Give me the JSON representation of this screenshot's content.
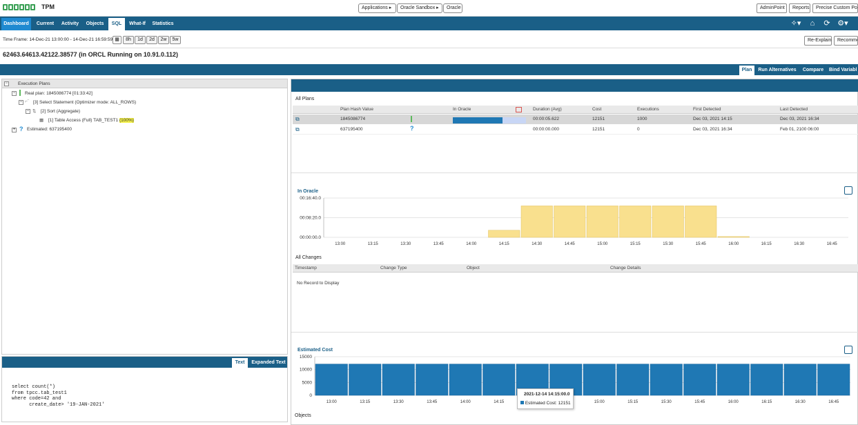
{
  "header": {
    "app_title": "TPM",
    "breadcrumbs": [
      "Applications",
      "Oracle Sandbox",
      "Oracle"
    ],
    "right_buttons": [
      "AdminPoint",
      "Reports",
      "Precise Custom Porta"
    ]
  },
  "nav": {
    "tabs": [
      "Dashboard",
      "Current",
      "Activity",
      "Objects",
      "SQL",
      "What-If",
      "Statistics"
    ],
    "active": "SQL"
  },
  "timeframe": {
    "label": "Time Frame: 14-Dec-21 13:00:00 - 14-Dec-21 16:59:59",
    "ranges": [
      "8h",
      "1d",
      "2d",
      "2w",
      "5w"
    ],
    "actions": [
      "Re-Explain",
      "Recommen"
    ]
  },
  "sql_id": "62463.64613.42122.38577 (in ORCL Running on 10.91.0.112)",
  "subtabs": {
    "items": [
      "Plan",
      "Run Alternatives",
      "Compare",
      "Bind Variabl"
    ],
    "active": "Plan"
  },
  "tree": {
    "header": "Execution Plans",
    "real_plan": "Real plan: 1845086774 [01:33:42]",
    "select": "[3] Select Statement (Optimizer mode: ALL_ROWS)",
    "sort": "[2] Sort (Aggregate)",
    "table_access": "[1] Table Access (Full) TAB_TEST1",
    "pct": "(100%)",
    "estimated": "Estimated: 637195400"
  },
  "sql_panel": {
    "tabs": [
      "Text",
      "Expanded Text"
    ],
    "active": "Text",
    "text": "select count(*)\nfrom tpcc.tab_test1\nwhere code=42 and\n      create_date> '19-JAN-2021'"
  },
  "all_plans": {
    "title": "All Plans",
    "columns": [
      "Plan Hash Value",
      "In Oracle",
      "Duration (Avg)",
      "Cost",
      "Executions",
      "First Detected",
      "Last Detected"
    ],
    "rows": [
      {
        "hash": "1845086774",
        "in_oracle_fraction": 0.68,
        "duration": "00:00:05.622",
        "cost": "12151",
        "executions": "1000",
        "first": "Dec 03, 2021 14:15",
        "last": "Dec 03, 2021 16:34",
        "status": "real"
      },
      {
        "hash": "637195400",
        "in_oracle_fraction": 0,
        "duration": "00:00:00.000",
        "cost": "12151",
        "executions": "0",
        "first": "Dec 03, 2021 16:34",
        "last": "Feb 01, 2100 06:00",
        "status": "estimated"
      }
    ]
  },
  "all_changes": {
    "title": "All Changes",
    "columns": [
      "Timestamp",
      "Change Type",
      "Object",
      "Change Details"
    ],
    "empty": "No Record to Display"
  },
  "objects_title": "Objects",
  "tooltip": {
    "time": "2021-12-14 14:15:00.0",
    "label": "Estimated Cost:",
    "value": "12151"
  },
  "colors": {
    "nav": "#1a5f87",
    "bar_in_oracle": "#f9e08e",
    "bar_cost": "#1f78b4",
    "accent": "#1f8ad1"
  },
  "chart_data": [
    {
      "type": "bar",
      "title": "In Oracle",
      "categories": [
        "13:00",
        "13:15",
        "13:30",
        "13:45",
        "14:00",
        "14:15",
        "14:30",
        "14:45",
        "15:00",
        "15:15",
        "15:30",
        "15:45",
        "16:00",
        "16:15",
        "16:30",
        "16:45"
      ],
      "y_tick_labels": [
        "00:00:00.0",
        "00:08:20.0",
        "00:16:40.0"
      ],
      "ylim": [
        0,
        1000
      ],
      "values": [
        0,
        0,
        0,
        0,
        0,
        180,
        800,
        800,
        800,
        800,
        800,
        800,
        20,
        0,
        0,
        0
      ]
    },
    {
      "type": "bar",
      "title": "Estimated Cost",
      "categories": [
        "13:00",
        "13:15",
        "13:30",
        "13:45",
        "14:00",
        "14:15",
        "14:30",
        "14:45",
        "15:00",
        "15:15",
        "15:30",
        "15:45",
        "16:00",
        "16:15",
        "16:30",
        "16:45"
      ],
      "y_tick_labels": [
        "0",
        "5000",
        "10000",
        "15000"
      ],
      "ylim": [
        0,
        15000
      ],
      "values": [
        12151,
        12151,
        12151,
        12151,
        12151,
        12151,
        12151,
        12151,
        12151,
        12151,
        12151,
        12151,
        12151,
        12151,
        12151,
        12151
      ]
    }
  ]
}
